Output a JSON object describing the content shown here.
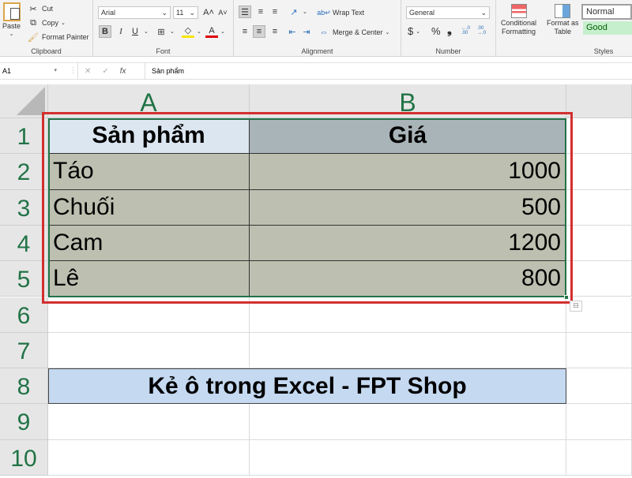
{
  "ribbon": {
    "clipboard": {
      "paste": "Paste",
      "cut": "Cut",
      "copy": "Copy",
      "format_painter": "Format Painter",
      "label": "Clipboard"
    },
    "font": {
      "name": "Arial",
      "size": "11",
      "bold": "B",
      "italic": "I",
      "underline": "U",
      "font_color": "A",
      "label": "Font"
    },
    "alignment": {
      "wrap_text": "Wrap Text",
      "merge_center": "Merge & Center",
      "label": "Alignment"
    },
    "number": {
      "format": "General",
      "currency": "$",
      "percent": "%",
      "comma": "❟",
      "inc_decimal": "←.0 .00",
      "dec_decimal": ".00 →.0",
      "label": "Number"
    },
    "styles": {
      "conditional_formatting": [
        "Conditional",
        "Formatting"
      ],
      "format_as_table": [
        "Format as",
        "Table"
      ],
      "normal": "Normal",
      "good": "Good",
      "label": "Styles"
    }
  },
  "formula_bar": {
    "name_box": "A1",
    "cancel": "✕",
    "enter": "✓",
    "fx": "fx",
    "content": "Sản phẩm"
  },
  "columns": [
    "A",
    "B"
  ],
  "rows": [
    "1",
    "2",
    "3",
    "4",
    "5",
    "6",
    "7",
    "8",
    "9",
    "10"
  ],
  "table": {
    "header": [
      "Sản phẩm",
      "Giá"
    ],
    "rows": [
      [
        "Táo",
        "1000"
      ],
      [
        "Chuối",
        "500"
      ],
      [
        "Cam",
        "1200"
      ],
      [
        "Lê",
        "800"
      ]
    ]
  },
  "banner": "Kẻ ô trong Excel - FPT Shop",
  "colors": {
    "header_a": "#dce6f1",
    "header_b": "#a9b4b8",
    "body": "#bdc0b0",
    "banner": "#c5d9f1",
    "highlight": "#d32f2f",
    "excel_green": "#217346"
  }
}
